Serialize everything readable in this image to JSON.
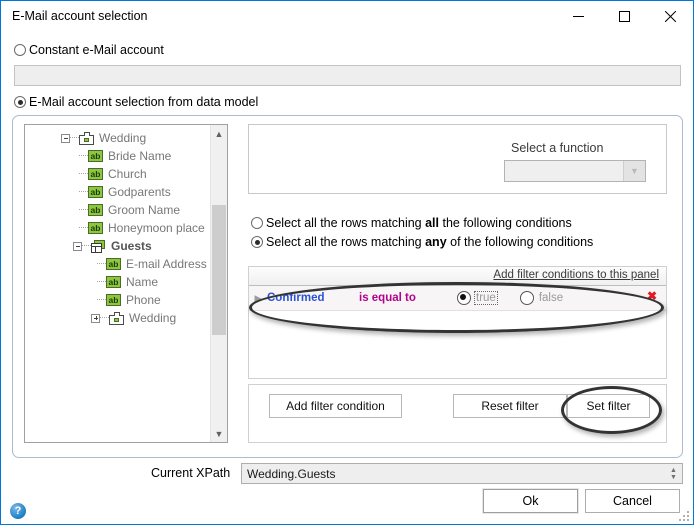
{
  "window": {
    "title": "E-Mail account selection",
    "minimize_label": "minimize",
    "maximize_label": "maximize",
    "close_label": "close"
  },
  "source_options": {
    "constant": {
      "label": "Constant e-Mail account",
      "selected": false,
      "value": ""
    },
    "from_model": {
      "label": "E-Mail account selection from data model",
      "selected": true
    }
  },
  "tree": {
    "nodes": [
      {
        "label": "Wedding",
        "icon": "entity-icon",
        "depth": 0,
        "expander": "minus",
        "bold": false
      },
      {
        "label": "Bride Name",
        "icon": "text-field-icon",
        "depth": 1,
        "expander": "none",
        "bold": false
      },
      {
        "label": "Church",
        "icon": "text-field-icon",
        "depth": 1,
        "expander": "none",
        "bold": false
      },
      {
        "label": "Godparents",
        "icon": "text-field-icon",
        "depth": 1,
        "expander": "none",
        "bold": false
      },
      {
        "label": "Groom Name",
        "icon": "text-field-icon",
        "depth": 1,
        "expander": "none",
        "bold": false
      },
      {
        "label": "Honeymoon place",
        "icon": "text-field-icon",
        "depth": 1,
        "expander": "none",
        "bold": false
      },
      {
        "label": "Guests",
        "icon": "table-icon",
        "depth": 1,
        "expander": "minus",
        "bold": true
      },
      {
        "label": "E-mail Address",
        "icon": "text-field-icon",
        "depth": 2,
        "expander": "none",
        "bold": false
      },
      {
        "label": "Name",
        "icon": "text-field-icon",
        "depth": 2,
        "expander": "none",
        "bold": false
      },
      {
        "label": "Phone",
        "icon": "text-field-icon",
        "depth": 2,
        "expander": "none",
        "bold": false
      },
      {
        "label": "Wedding",
        "icon": "entity-icon",
        "depth": 2,
        "expander": "plus",
        "bold": false
      }
    ]
  },
  "function_panel": {
    "label": "Select a function",
    "combo_value": "",
    "combo_enabled": false
  },
  "match_options": [
    {
      "prefix": "Select all the rows matching ",
      "emphasis": "all",
      "suffix": " the following conditions",
      "selected": false
    },
    {
      "prefix": "Select all the rows matching ",
      "emphasis": "any",
      "suffix": " of the following conditions",
      "selected": true
    }
  ],
  "conditions_panel": {
    "add_link": "Add filter conditions to this panel",
    "rows": [
      {
        "field": "Confirmed",
        "operator": "is equal to",
        "values": [
          {
            "label": "true",
            "selected": true,
            "focused": true
          },
          {
            "label": "false",
            "selected": false,
            "focused": false
          }
        ],
        "delete_label": "✖"
      }
    ]
  },
  "filter_buttons": {
    "add": "Add filter condition",
    "reset": "Reset  filter",
    "set": "Set  filter"
  },
  "footer": {
    "xpath_label": "Current XPath",
    "xpath_value": "Wedding.Guests",
    "ok": "Ok",
    "cancel": "Cancel",
    "help": "?"
  },
  "colors": {
    "window_border": "#0078d7",
    "field_name": "#2a52d6",
    "operator": "#b5008e",
    "delete": "#e01b24",
    "node_icon_green": "#8dc63f",
    "help_blue": "#1b7fc4"
  },
  "highlights": [
    {
      "name": "condition-row-highlight"
    },
    {
      "name": "set-filter-highlight"
    }
  ]
}
